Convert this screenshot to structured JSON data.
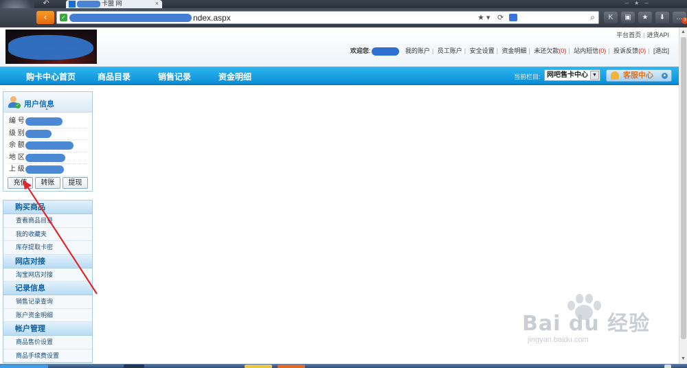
{
  "browser": {
    "tab_title": "卡盟 网",
    "tab_close": "×",
    "new_tab": "+",
    "address_url": "ndex.aspx",
    "secure_icon": "shield-check-icon",
    "star": "★",
    "refresh": "⟳",
    "search_icon": "magnifier-icon",
    "toolbar_icons": [
      "K",
      "🔒",
      "★",
      "⬇",
      "…"
    ]
  },
  "header": {
    "top_links": [
      "平台首页",
      "进货API"
    ],
    "welcome": "欢迎您",
    "user_links": [
      "我的账户",
      "员工账户",
      "安全设置",
      "资金明细",
      "未还欠款",
      "站内短信",
      "投诉反馈",
      "退出"
    ],
    "debt_label": "未还欠款",
    "debt_count": "(0)",
    "msg_label": "站内短信",
    "msg_count": "(0)",
    "complaint_label": "投诉反馈",
    "complaint_count": "(0)",
    "logout": "[退出]"
  },
  "nav": {
    "items": [
      "购卡中心首页",
      "商品目录",
      "销售记录",
      "资金明细"
    ],
    "current_label": "当前栏目:",
    "current_value": "网吧售卡中心",
    "service_button": "客服中心"
  },
  "user_info": {
    "title": "用户信息",
    "fields": [
      "编 号",
      "级 别",
      "余 额",
      "地 区",
      "上 级"
    ],
    "buttons": [
      "充值",
      "转账",
      "提现"
    ]
  },
  "side_menu": {
    "sections": [
      {
        "title": "购买商品",
        "items": [
          "查看商品目录",
          "我的收藏夹",
          "库存提取卡密"
        ]
      },
      {
        "title": "网店对接",
        "items": [
          "淘宝网店对接"
        ]
      },
      {
        "title": "记录信息",
        "items": [
          "销售记录查询",
          "账户资金明细"
        ]
      },
      {
        "title": "帐户管理",
        "items": [
          "商品售价设置",
          "商品手续费设置"
        ]
      }
    ]
  },
  "watermark": {
    "brand": "Bai du 经验",
    "url": "jingyan.baidu.com"
  },
  "colors": {
    "nav_blue": "#1aa3e6",
    "annotation_red": "#e0262a",
    "link_blue": "#0f6fbf"
  }
}
